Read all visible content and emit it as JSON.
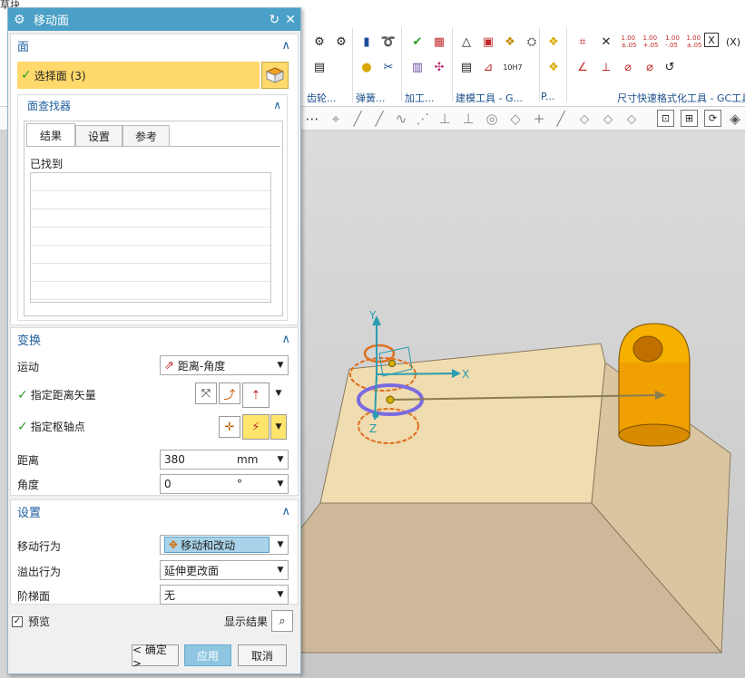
{
  "dialog": {
    "title": "移动面",
    "face_section": {
      "title": "面",
      "select_label": "选择面 (3)"
    },
    "finder": {
      "title": "面查找器",
      "tabs": [
        "结果",
        "设置",
        "参考"
      ],
      "found_label": "已找到"
    },
    "transform": {
      "title": "变换",
      "motion_label": "运动",
      "motion_value": "距离-角度",
      "distance_vector_label": "指定距离矢量",
      "pivot_label": "指定枢轴点",
      "distance_label": "距离",
      "distance_value": "380",
      "distance_unit": "mm",
      "angle_label": "角度",
      "angle_value": "0",
      "angle_unit": "°"
    },
    "settings": {
      "title": "设置",
      "move_behavior_label": "移动行为",
      "move_behavior_value": "移动和改动",
      "overflow_label": "溢出行为",
      "overflow_value": "延伸更改面",
      "step_label": "阶梯面",
      "step_value": "无"
    },
    "preview_label": "预览",
    "show_result_label": "显示结果",
    "ok_label": "< 确定 >",
    "apply_label": "应用",
    "cancel_label": "取消"
  },
  "ribbon": {
    "crumb": "草块",
    "groups": [
      "齿轮...",
      "弹簧...",
      "加工...",
      "建模工具 - G...",
      "P...",
      "尺寸快速格式化工具 - GC工具"
    ],
    "tolerance_labels": [
      "1.00\n±.05",
      "1.00\n+.05",
      "1.00\n-.05",
      "1.00\n±.05"
    ],
    "fit_label": "10H7"
  },
  "viewport": {
    "axis_x": "X",
    "axis_y": "Y",
    "axis_z": "Z"
  },
  "colors": {
    "title_bar": "#4aa0c6",
    "selection_highlight": "#ffd96b",
    "section_header": "#1f5fa0",
    "apply_button": "#8ec6e2",
    "face_selected": "#e07020",
    "part_orange": "#f5a000"
  }
}
